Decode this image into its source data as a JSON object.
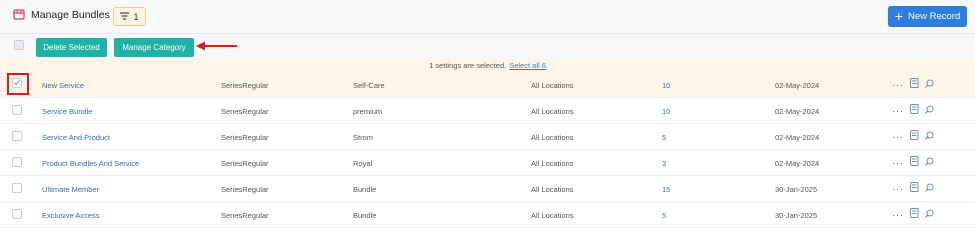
{
  "header": {
    "title": "Manage Bundles",
    "filter_count": "1",
    "new_record_label": "New Record"
  },
  "toolbar": {
    "delete_label": "Delete Selected",
    "manage_category_label": "Manage Category"
  },
  "selection": {
    "text": "1 settings are selected.",
    "select_all_label": "Select all 6"
  },
  "rows": [
    {
      "name": "New Service",
      "series": "SeriesRegular",
      "category": "Self-Care",
      "location": "All Locations",
      "count": "10",
      "date": "02-May-2024",
      "selected": true
    },
    {
      "name": "Service Bundle",
      "series": "SeriesRegular",
      "category": "premium",
      "location": "All Locations",
      "count": "10",
      "date": "02-May-2024",
      "selected": false
    },
    {
      "name": "Service And Product",
      "series": "SeriesRegular",
      "category": "Strom",
      "location": "All Locations",
      "count": "5",
      "date": "02-May-2024",
      "selected": false
    },
    {
      "name": "Product Bundles And Service",
      "series": "SeriesRegular",
      "category": "Royal",
      "location": "All Locations",
      "count": "3",
      "date": "02-May-2024",
      "selected": false
    },
    {
      "name": "Ultimate Member",
      "series": "SeriesRegular",
      "category": "Bundle",
      "location": "All Locations",
      "count": "15",
      "date": "30-Jan-2025",
      "selected": false
    },
    {
      "name": "Exclusive Access",
      "series": "SeriesRegular",
      "category": "Bundle",
      "location": "All Locations",
      "count": "5",
      "date": "30-Jan-2025",
      "selected": false
    }
  ],
  "icons": {
    "header": "bundle-box-icon",
    "filter": "filter-icon",
    "new": "plus-icon",
    "more": "more-dots-icon",
    "edit": "edit-note-icon",
    "search": "search-icon",
    "arrow": "red-arrow-icon"
  },
  "colors": {
    "primary": "#2f7de1",
    "teal": "#20b2a6",
    "highlight": "#d21f1f",
    "selected_row": "#fdf6e7"
  }
}
